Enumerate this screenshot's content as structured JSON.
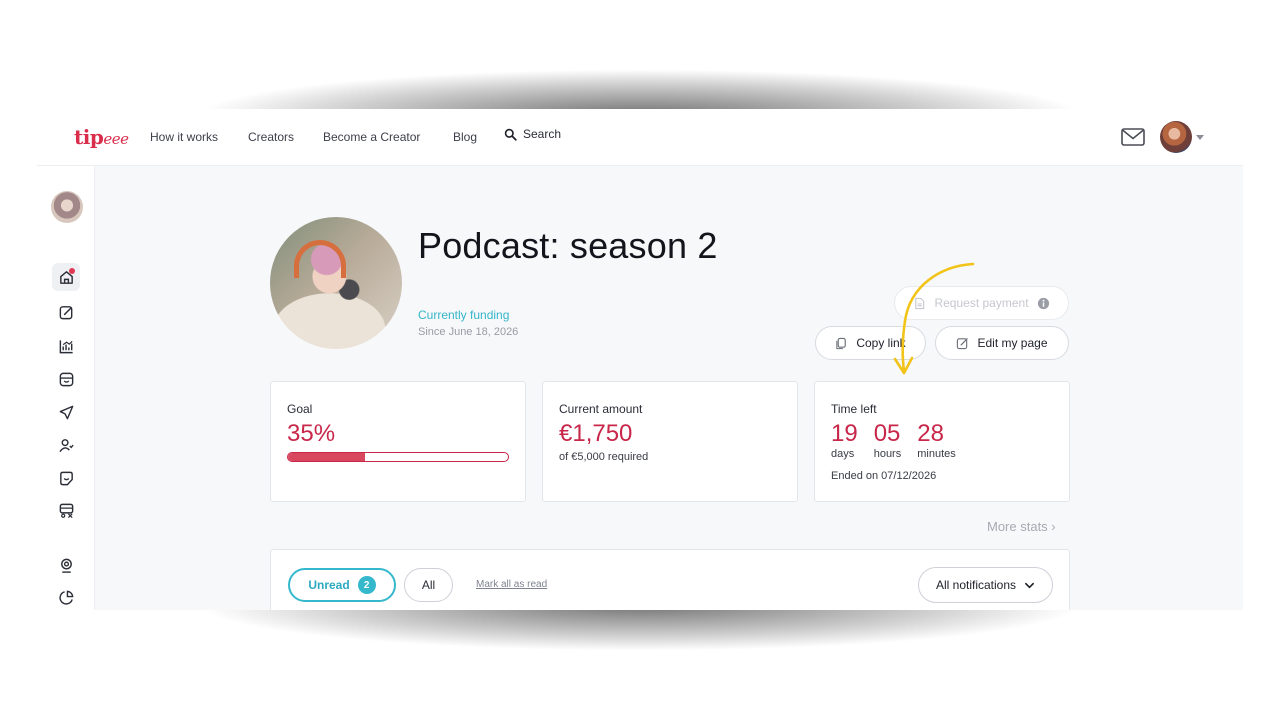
{
  "nav": {
    "logo": "tip",
    "logo_tail": "eee",
    "links": [
      "How it works",
      "Creators",
      "Become a Creator",
      "Blog"
    ],
    "search_label": "Search"
  },
  "page": {
    "title": "Podcast: season 2",
    "funding_status": "Currently funding",
    "funding_since": "Since June 18, 2026"
  },
  "actions": {
    "request_payment": "Request payment",
    "copy_link": "Copy link",
    "edit_page": "Edit my page"
  },
  "stats": {
    "goal_label": "Goal",
    "goal_value": "35%",
    "goal_progress": 0.35,
    "amount_label": "Current amount",
    "amount_value": "€1,750",
    "amount_sub": "of €5,000 required",
    "time_label": "Time left",
    "days": "19",
    "days_unit": "days",
    "hours": "05",
    "hours_unit": "hours",
    "minutes": "28",
    "minutes_unit": "minutes",
    "ended": "Ended on 07/12/2026",
    "more_stats": "More stats ›"
  },
  "notifications": {
    "unread_label": "Unread",
    "unread_count": "2",
    "all_label": "All",
    "mark_all": "Mark all as read",
    "filter": "All notifications"
  },
  "sidebar": {
    "icons": [
      "home-icon",
      "edit-icon",
      "stats-icon",
      "inbox-icon",
      "send-icon",
      "user-add-icon",
      "sticker-icon",
      "bus-settings-icon",
      "webcam-icon",
      "pie-icon"
    ]
  },
  "colors": {
    "brand": "#d92d4b",
    "accent": "#35b8cc",
    "value_red": "#c8274a",
    "annotation_arrow": "#f2c318"
  }
}
